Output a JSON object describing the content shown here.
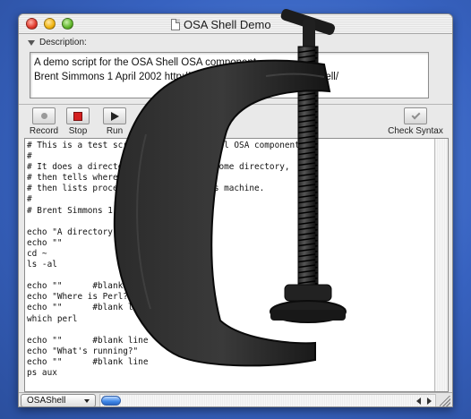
{
  "window": {
    "title": "OSA Shell Demo"
  },
  "description": {
    "label": "Description:",
    "lines": [
      "A demo script for the OSA Shell OSA component.",
      "Brent Simmons 1 April 2002 http://ranchero.com/software/osashell/"
    ]
  },
  "toolbar": {
    "record_label": "Record",
    "stop_label": "Stop",
    "run_label": "Run",
    "check_syntax_label": "Check Syntax"
  },
  "script": {
    "lines": [
      "# This is a test script for the OSAShell OSA component.",
      "#",
      "# It does a directory listing of the home directory,",
      "# then tells where Perl is installed,",
      "# then lists processes running on this machine.",
      "#",
      "# Brent Simmons 1 April 2002",
      "",
      "echo \"A directory listing:\"",
      "echo \"\"",
      "cd ~",
      "ls -al",
      "",
      "echo \"\"      #blank line",
      "echo \"Where is Perl?\"",
      "echo \"\"      #blank line",
      "which perl",
      "",
      "echo \"\"      #blank line",
      "echo \"What's running?\"",
      "echo \"\"      #blank line",
      "ps aux"
    ]
  },
  "bottom": {
    "language": "OSAShell"
  },
  "colors": {
    "desktop": "#3d6bc4",
    "stop_button": "#d41f1f",
    "scroll_thumb": "#3f87e8"
  }
}
